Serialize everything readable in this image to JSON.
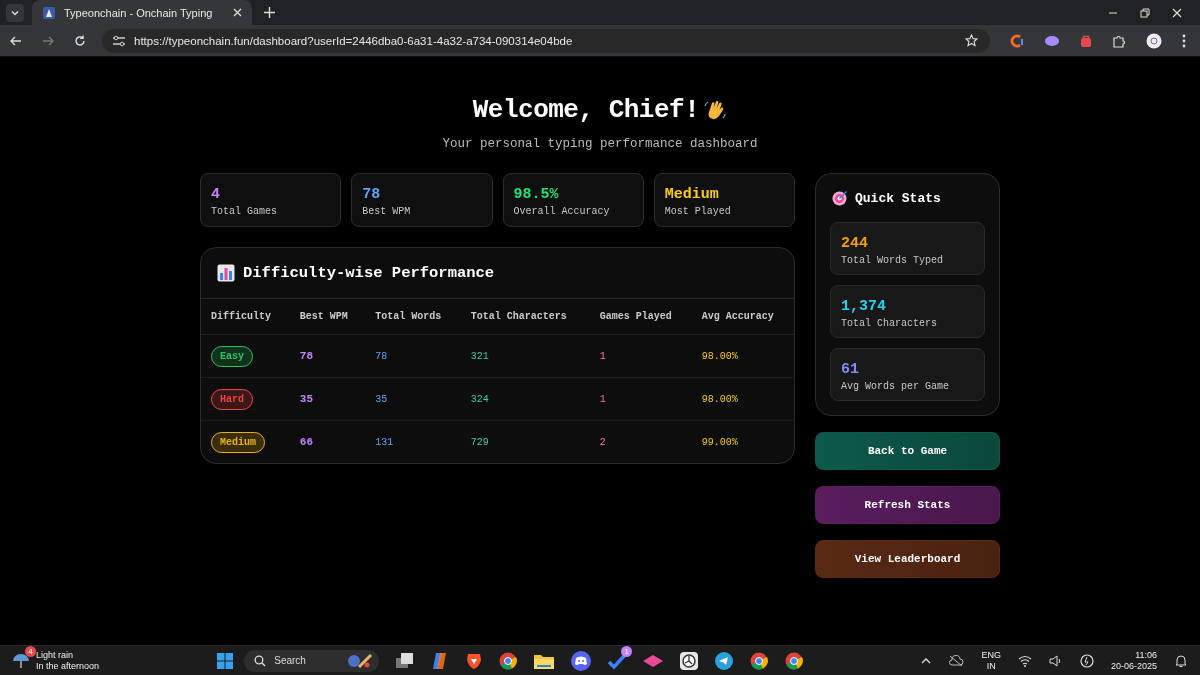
{
  "browser": {
    "tab_title": "Typeonchain - Onchain Typing",
    "url": "https://typeonchain.fun/dashboard?userId=2446dba0-6a31-4a32-a734-090314e04bde"
  },
  "header": {
    "title": "Welcome, Chief!",
    "subtitle": "Your personal typing performance dashboard"
  },
  "stat_cards": [
    {
      "value": "4",
      "label": "Total Games",
      "color": "#c084fc"
    },
    {
      "value": "78",
      "label": "Best WPM",
      "color": "#60a5fa"
    },
    {
      "value": "98.5%",
      "label": "Overall Accuracy",
      "color": "#22e07a"
    },
    {
      "value": "Medium",
      "label": "Most Played",
      "color": "#facc15"
    }
  ],
  "performance": {
    "title": "Difficulty-wise Performance",
    "columns": [
      "Difficulty",
      "Best WPM",
      "Total Words",
      "Total Characters",
      "Games Played",
      "Avg Accuracy"
    ],
    "rows": [
      {
        "difficulty": "Easy",
        "color": "#22c55e",
        "best_wpm": "78",
        "total_words": "78",
        "total_characters": "321",
        "games_played": "1",
        "avg_accuracy": "98.00%"
      },
      {
        "difficulty": "Hard",
        "color": "#ef4444",
        "best_wpm": "35",
        "total_words": "35",
        "total_characters": "324",
        "games_played": "1",
        "avg_accuracy": "98.00%"
      },
      {
        "difficulty": "Medium",
        "color": "#eab308",
        "best_wpm": "66",
        "total_words": "131",
        "total_characters": "729",
        "games_played": "2",
        "avg_accuracy": "99.00%"
      }
    ]
  },
  "quick_stats": {
    "title": "Quick Stats",
    "items": [
      {
        "value": "244",
        "label": "Total Words Typed",
        "color": "#f59e0b"
      },
      {
        "value": "1,374",
        "label": "Total Characters",
        "color": "#22d3ee"
      },
      {
        "value": "61",
        "label": "Avg Words per Game",
        "color": "#818cf8"
      }
    ]
  },
  "buttons": [
    {
      "label": "Back to Game",
      "color": "#0d5a4a"
    },
    {
      "label": "Refresh Stats",
      "color": "#5a1d5e"
    },
    {
      "label": "View Leaderboard",
      "color": "#5a2a14"
    }
  ],
  "taskbar": {
    "weather_badge": "4",
    "weather_title": "Light rain",
    "weather_subtitle": "In the afternoon",
    "search_placeholder": "Search",
    "app_badge": "1",
    "language": "ENG",
    "region": "IN",
    "time": "11:06",
    "date": "20-06-2025"
  }
}
